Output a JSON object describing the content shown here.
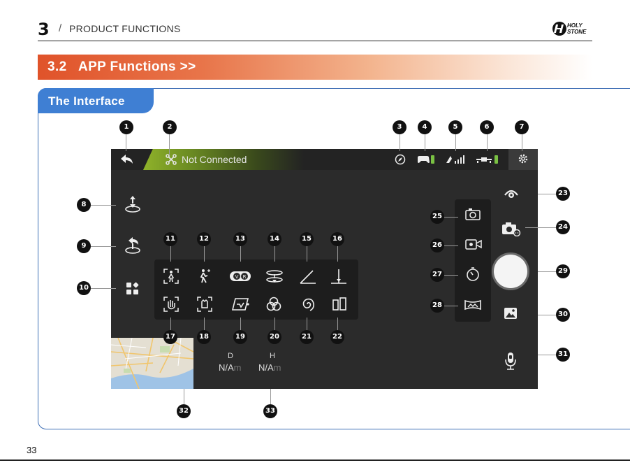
{
  "header": {
    "chapter": "3",
    "slash": "/",
    "title": "PRODUCT FUNCTIONS",
    "brand": "HOLY STONE"
  },
  "banner": {
    "title": "3.2   APP Functions >>"
  },
  "section_tab": "The Interface",
  "app": {
    "status": "Not Connected",
    "readouts": [
      {
        "label": "D",
        "value": "N/A",
        "unit": "m"
      },
      {
        "label": "H",
        "value": "N/A",
        "unit": "m"
      }
    ],
    "icons": {
      "back": "back-arrow-icon",
      "connection": "drone-connection-icon",
      "compass": "compass-icon",
      "controller_battery": "controller-battery-icon",
      "gps_signal": "gps-signal-icon",
      "drone_battery": "drone-battery-icon",
      "settings": "gear-icon",
      "takeoff": "takeoff-land-icon",
      "return_home": "return-home-icon",
      "flight_modes": "flight-modes-icon",
      "camera_angle": "camera-tilt-icon",
      "camera_settings": "camera-settings-icon",
      "photo": "photo-mode-icon",
      "video": "video-mode-icon",
      "timer": "timer-icon",
      "panorama": "panorama-icon",
      "shutter": "shutter-button",
      "gallery": "gallery-icon",
      "voice": "voice-control-icon"
    },
    "flight_mode_icons": [
      "follow-me-icon",
      "point-of-interest-icon",
      "vr-icon",
      "circle-fly-icon",
      "custom-flight-path-icon",
      "waypoint-altitude-icon",
      "gesture-photo-icon",
      "gesture-video-icon",
      "tap-fly-icon",
      "filter-icon",
      "spiral-icon",
      "split-screen-icon"
    ]
  },
  "markers": [
    "1",
    "2",
    "3",
    "4",
    "5",
    "6",
    "7",
    "8",
    "9",
    "10",
    "11",
    "12",
    "13",
    "14",
    "15",
    "16",
    "17",
    "18",
    "19",
    "20",
    "21",
    "22",
    "23",
    "24",
    "25",
    "26",
    "27",
    "28",
    "29",
    "30",
    "31",
    "32",
    "33"
  ],
  "page_number": "33"
}
